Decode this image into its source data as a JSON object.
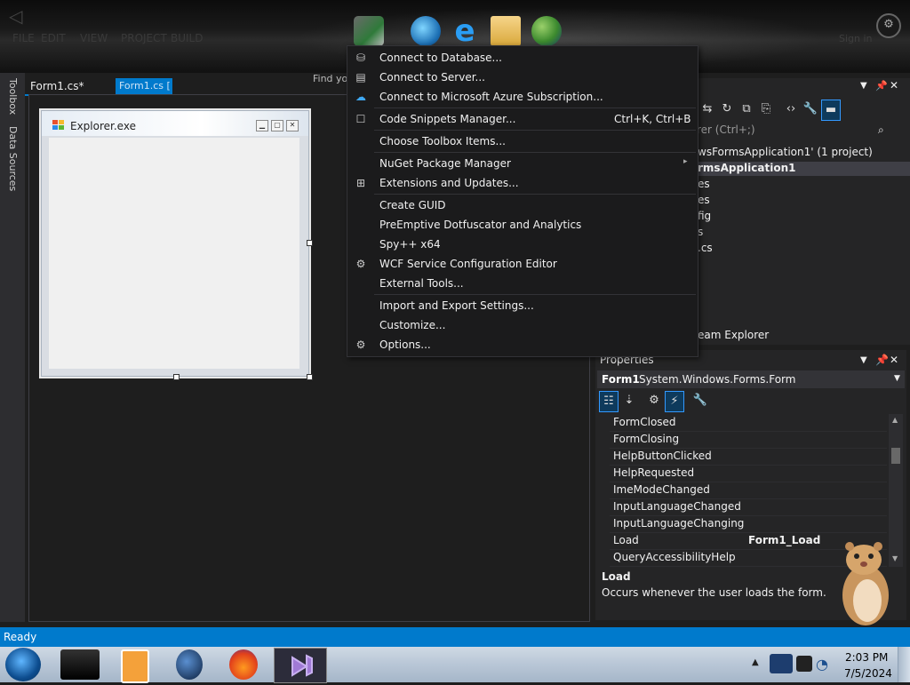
{
  "colors": {
    "accent": "#007acc",
    "menu_bg": "#1b1b1c",
    "panel_bg": "#252526",
    "status": "#007acc"
  },
  "header": {
    "signin_label": "Sign in",
    "find_label": "Find you",
    "settings_icon": "gear-icon"
  },
  "left_tabs": [
    {
      "label": "Toolbox"
    },
    {
      "label": "Data Sources"
    }
  ],
  "doc_tabs": [
    {
      "label": "Form1.cs*"
    },
    {
      "label": "Form1.cs ["
    }
  ],
  "form": {
    "title": "Explorer.exe",
    "min": "▁",
    "max": "▢",
    "close": "✕"
  },
  "tools_menu": {
    "items": [
      {
        "label": "Connect to Database...",
        "shortcut": "",
        "icon": "database-icon"
      },
      {
        "label": "Connect to Server...",
        "shortcut": "",
        "icon": "server-icon"
      },
      {
        "label": "Connect to Microsoft Azure Subscription...",
        "shortcut": "",
        "icon": "cloud-icon"
      },
      {
        "label": "Code Snippets Manager...",
        "shortcut": "Ctrl+K, Ctrl+B",
        "icon": "checkbox-icon"
      },
      {
        "label": "Choose Toolbox Items...",
        "shortcut": "",
        "icon": ""
      },
      {
        "label": "NuGet Package Manager",
        "shortcut": "",
        "icon": "",
        "submenu": true
      },
      {
        "label": "Extensions and Updates...",
        "shortcut": "",
        "icon": "extensions-icon"
      },
      {
        "label": "Create GUID",
        "shortcut": "",
        "icon": ""
      },
      {
        "label": "PreEmptive Dotfuscator and Analytics",
        "shortcut": "",
        "icon": ""
      },
      {
        "label": "Spy++ x64",
        "shortcut": "",
        "icon": ""
      },
      {
        "label": "WCF Service Configuration Editor",
        "shortcut": "",
        "icon": "wcf-gear-icon"
      },
      {
        "label": "External Tools...",
        "shortcut": "",
        "icon": ""
      },
      {
        "label": "Import and Export Settings...",
        "shortcut": "",
        "icon": ""
      },
      {
        "label": "Customize...",
        "shortcut": "",
        "icon": ""
      },
      {
        "label": "Options...",
        "shortcut": "",
        "icon": "gear-icon"
      }
    ]
  },
  "solution_explorer": {
    "search_placeholder": "rer (Ctrl+;)",
    "lines": [
      "wsFormsApplication1' (1 project)",
      "rmsApplication1",
      "es",
      "es",
      "fig",
      "s",
      ".cs"
    ],
    "team_explorer_label": "eam Explorer"
  },
  "properties": {
    "title": "Properties",
    "object_name": "Form1",
    "object_type": "System.Windows.Forms.Form",
    "rows": [
      {
        "name": "FormClosed",
        "value": ""
      },
      {
        "name": "FormClosing",
        "value": ""
      },
      {
        "name": "HelpButtonClicked",
        "value": ""
      },
      {
        "name": "HelpRequested",
        "value": ""
      },
      {
        "name": "ImeModeChanged",
        "value": ""
      },
      {
        "name": "InputLanguageChanged",
        "value": ""
      },
      {
        "name": "InputLanguageChanging",
        "value": ""
      },
      {
        "name": "Load",
        "value": "Form1_Load"
      },
      {
        "name": "QueryAccessibilityHelp",
        "value": ""
      }
    ],
    "description_name": "Load",
    "description_text": "Occurs whenever the user loads the form."
  },
  "status": {
    "text": "Ready"
  },
  "clock": {
    "time": "2:03 PM",
    "date": "7/5/2024"
  }
}
